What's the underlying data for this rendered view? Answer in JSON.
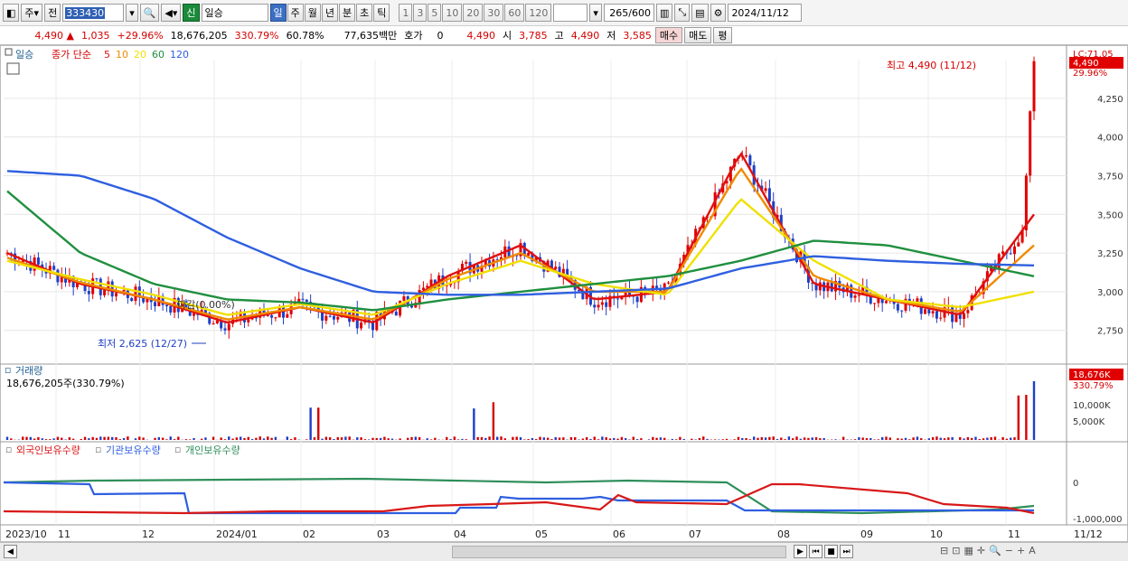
{
  "toolbar": {
    "period_type": "주",
    "prev_label": "전",
    "stock_code": "333430",
    "market_badge": "신",
    "stock_name": "일승",
    "tabs": [
      "일",
      "주",
      "월",
      "년",
      "분",
      "초",
      "틱"
    ],
    "active_tab": "일",
    "intervals": [
      "1",
      "3",
      "5",
      "10",
      "20",
      "30",
      "60",
      "120"
    ],
    "count_display": "265",
    "count_total": "/600",
    "date": "2024/11/12"
  },
  "quote": {
    "price": "4,490",
    "change": "1,035",
    "change_pct": "+29.96%",
    "volume": "18,676,205",
    "volume_ratio": "330.79%",
    "turnover": "60.78%",
    "amount": "77,635백만",
    "hoga_label": "호가",
    "hoga_value": "0",
    "hoga_price": "4,490",
    "open_label": "시",
    "open": "3,785",
    "high_label": "고",
    "high": "4,490",
    "low_label": "저",
    "low": "3,585",
    "buy_label": "매수",
    "sell_label": "매도",
    "extra_label": "평"
  },
  "price_panel": {
    "stock_label": "일승",
    "ma_title": "종가 단순",
    "ma_periods": [
      "5",
      "10",
      "20",
      "60",
      "120"
    ],
    "ma_colors": [
      "#e01010",
      "#f08a00",
      "#f0e000",
      "#1f8f3f",
      "#2f5fe0"
    ],
    "high_annotation": "최고 4,490 (11/12)",
    "low_annotation": "최저 2,625 (12/27)",
    "watermark_label": "마감(0.00%)",
    "current_tag": "4,490",
    "current_pct_tag": "29.96%",
    "top_tag": "LC:71.05",
    "y_ticks": [
      "4,250",
      "4,000",
      "3,750",
      "3,500",
      "3,250",
      "3,000",
      "2,750"
    ]
  },
  "volume_panel": {
    "title": "거래량",
    "value": "18,676,205주(330.79%)",
    "tag": "18,676K",
    "tag_pct": "330.79%",
    "y_ticks": [
      "10,000K",
      "5,000K"
    ]
  },
  "holdings_panel": {
    "labels": [
      "외국인보유수량",
      "기관보유수량",
      "개인보유수량"
    ],
    "colors": [
      "#d81818",
      "#2f5fe0",
      "#2f8f5a"
    ],
    "y_ticks": [
      "0",
      "-1,000,000"
    ]
  },
  "x_axis": {
    "labels": [
      "2023/10",
      "11",
      "12",
      "2024/01",
      "02",
      "03",
      "04",
      "05",
      "06",
      "07",
      "08",
      "09",
      "10",
      "11",
      "11/12"
    ]
  },
  "chart_data": {
    "type": "line",
    "price_range": [
      2625,
      4490
    ],
    "x": [
      "2023/10",
      "11",
      "12",
      "2024/01",
      "02",
      "03",
      "04",
      "05",
      "06",
      "07",
      "08",
      "09",
      "10",
      "11",
      "11/12"
    ],
    "series": [
      {
        "name": "5",
        "values": [
          3250,
          3050,
          2950,
          2800,
          2900,
          2800,
          3100,
          3300,
          2950,
          3000,
          3900,
          3050,
          2950,
          2850,
          3500
        ]
      },
      {
        "name": "10",
        "values": [
          3220,
          3060,
          2950,
          2820,
          2900,
          2820,
          3080,
          3250,
          3000,
          3000,
          3800,
          3100,
          2950,
          2870,
          3300
        ]
      },
      {
        "name": "20",
        "values": [
          3200,
          3080,
          2980,
          2850,
          2920,
          2850,
          3050,
          3200,
          3050,
          2980,
          3600,
          3200,
          2950,
          2900,
          3000
        ]
      },
      {
        "name": "60",
        "values": [
          3650,
          3250,
          3050,
          2950,
          2930,
          2880,
          2950,
          3000,
          3050,
          3100,
          3200,
          3330,
          3300,
          3200,
          3100
        ]
      },
      {
        "name": "120",
        "values": [
          3780,
          3750,
          3600,
          3350,
          3150,
          3000,
          2980,
          2980,
          3000,
          3020,
          3150,
          3230,
          3200,
          3180,
          3170
        ]
      }
    ]
  }
}
